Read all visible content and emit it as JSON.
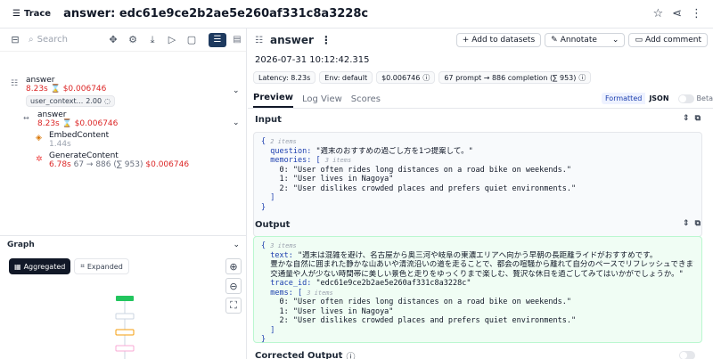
{
  "header": {
    "trace_label": "Trace",
    "title": "answer: edc61e9ce2b2ae5e260af331c8a3228c"
  },
  "left": {
    "search_placeholder": "Search",
    "tree": [
      {
        "name": "answer",
        "latency": "8.23s",
        "cost": "$0.006746",
        "chip_label": "user_context...",
        "chip_value": "2.00"
      },
      {
        "name": "answer",
        "latency": "8.23s",
        "cost": "$0.006746"
      },
      {
        "name": "EmbedContent",
        "latency": "1.44s"
      },
      {
        "name": "GenerateContent",
        "latency": "6.78s",
        "tokens": "67 → 886 (∑ 953)",
        "cost": "$0.006746"
      }
    ],
    "graph": {
      "title": "Graph",
      "aggregated": "Aggregated",
      "expanded": "Expanded"
    }
  },
  "right": {
    "title": "answer",
    "actions": {
      "add_to_datasets": "Add to datasets",
      "annotate": "Annotate",
      "add_comment": "Add comment"
    },
    "timestamp": "2026-07-31 10:12:42.315",
    "badges": {
      "latency": "Latency: 8.23s",
      "env": "Env: default",
      "cost": "$0.006746",
      "tokens": "67 prompt → 886 completion (∑ 953)"
    },
    "tabs": [
      "Preview",
      "Log View",
      "Scores"
    ],
    "format": {
      "formatted": "Formatted",
      "json": "JSON",
      "beta": "Beta"
    },
    "input": {
      "title": "Input",
      "count": "2 items",
      "question_key": "question:",
      "question_val": "\"週末のおすすめの過ごし方を1つ提案して。\"",
      "memories_key": "memories:",
      "memories_count": "3 items",
      "memories": [
        "0: \"User often rides long distances on a road bike on weekends.\"",
        "1: \"User lives in Nagoya\"",
        "2: \"User dislikes crowded places and prefers quiet environments.\""
      ]
    },
    "output": {
      "title": "Output",
      "count": "3 items",
      "text_key": "text:",
      "text_lines": [
        "\"週末は混雑を避け、名古屋から奥三河や岐阜の東濃エリアへ向かう早朝の長距離ライドがおすすめです。",
        "豊かな自然に囲まれた静かな山あいや清流沿いの道を走ることで、都会の喧騒から離れて自分のペースでリフレッシュできます。",
        "交通量や人が少ない時間帯に美しい景色と走りをゆっくりまで楽しむ、贅沢な休日を過ごしてみてはいかがでしょうか。\""
      ],
      "trace_id_key": "trace_id:",
      "trace_id_val": "\"edc61e9ce2b2ae5e260af331c8a3228c\"",
      "mems_key": "mems:",
      "mems_count": "3 items",
      "mems": [
        "0: \"User often rides long distances on a road bike on weekends.\"",
        "1: \"User lives in Nagoya\"",
        "2: \"User dislikes crowded places and prefers quiet environments.\""
      ]
    },
    "corrected_output": "Corrected Output"
  }
}
